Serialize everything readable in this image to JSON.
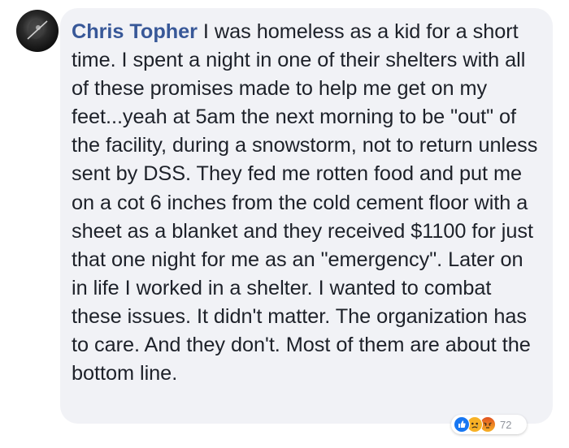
{
  "comment": {
    "author": "Chris Topher",
    "text": "I was homeless as a kid for a short time. I spent a night in one of their shelters with all of these promises made to help me get on my feet...yeah at 5am the next morning to be \"out\" of the facility, during a snowstorm, not to return unless sent by DSS. They fed me rotten food and put me on a cot 6 inches from the cold cement floor with a sheet as a blanket and they received $1100 for just that one night for me as an \"emergency\". Later on in life I worked in a shelter. I wanted to combat these issues. It didn't matter. The organization has to care. And they don't. Most of them are about the bottom line."
  },
  "reactions": {
    "icons": [
      "like-icon",
      "sad-icon",
      "angry-icon"
    ],
    "count": "72"
  },
  "colors": {
    "author_link": "#385898",
    "bubble_bg": "#f1f2f6",
    "text": "#1d2129",
    "like": "#1877f2",
    "sad": "#f7b125",
    "angry": "#e9710f"
  }
}
